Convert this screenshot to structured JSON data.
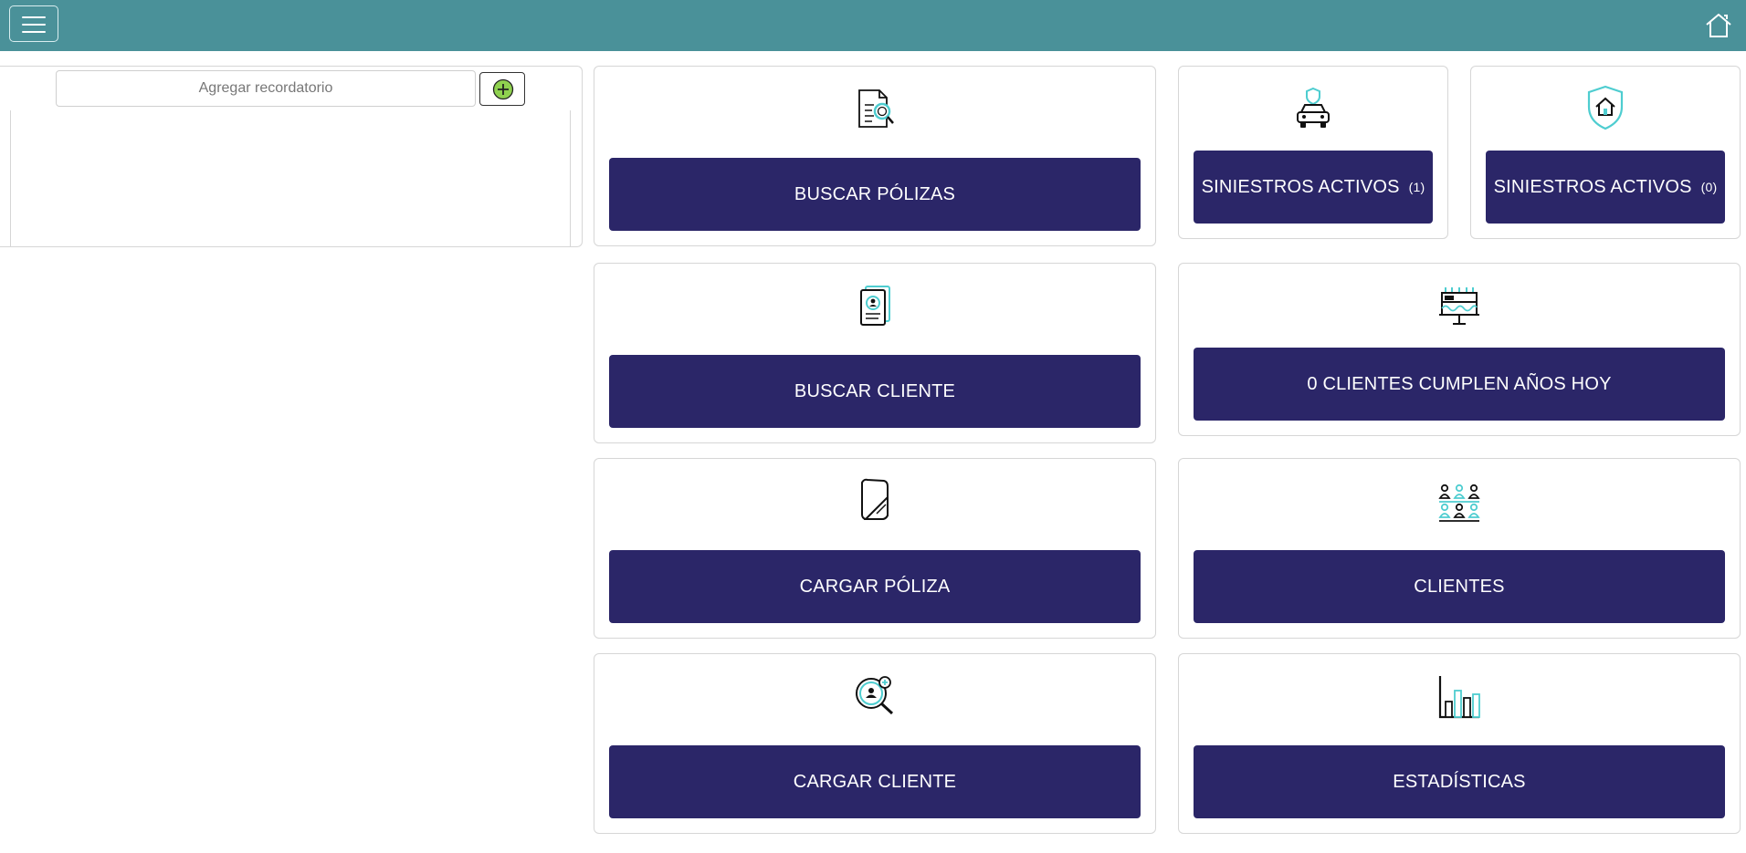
{
  "header": {
    "menu_icon": "hamburger-menu-icon",
    "home_icon": "home-icon",
    "background": "#4a9199"
  },
  "reminders": {
    "input_placeholder": "Agregar recordatorio",
    "input_value": "",
    "add_icon": "plus-circle-icon"
  },
  "cards": {
    "buscar_polizas": {
      "label": "BUSCAR PÓLIZAS",
      "icon": "document-search-icon"
    },
    "siniestros_auto": {
      "label": "SINIESTROS ACTIVOS",
      "count": "(1)",
      "icon": "car-shield-icon"
    },
    "siniestros_hogar": {
      "label": "SINIESTROS ACTIVOS",
      "count": "(0)",
      "icon": "home-shield-icon"
    },
    "buscar_cliente": {
      "label": "BUSCAR CLIENTE",
      "icon": "client-card-icon"
    },
    "cumpleanos": {
      "label": "0 CLIENTES CUMPLEN AÑOS HOY",
      "icon": "birthday-cake-icon"
    },
    "cargar_poliza": {
      "label": "CARGAR PÓLIZA",
      "icon": "paper-upload-icon"
    },
    "clientes": {
      "label": "CLIENTES",
      "icon": "people-group-icon"
    },
    "cargar_cliente": {
      "label": "CARGAR CLIENTE",
      "icon": "add-client-magnifier-icon"
    },
    "estadisticas": {
      "label": "ESTADÍSTICAS",
      "icon": "bar-chart-icon"
    }
  },
  "colors": {
    "button": "#2b2668",
    "accent": "#4ecdd0",
    "add_icon": "#8fd14f"
  }
}
